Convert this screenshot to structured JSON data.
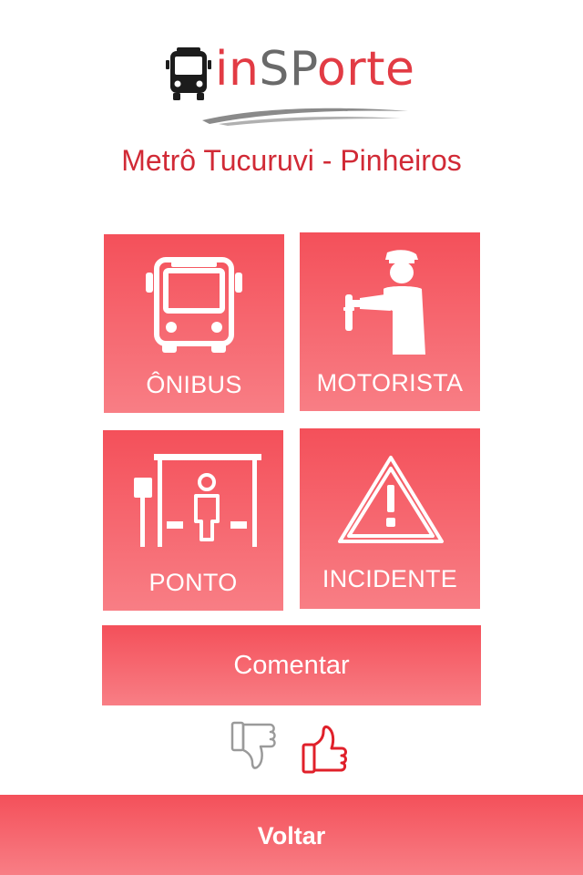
{
  "logo": {
    "text_red": "in",
    "text_gray": "SP",
    "text_red2": "orte",
    "brand_red": "#e23b44",
    "brand_gray": "#6a6a6a",
    "icon": "bus-front-icon"
  },
  "route": {
    "title": "Metrô Tucuruvi - Pinheiros"
  },
  "tiles": {
    "onibus": {
      "label": "ÔNIBUS",
      "icon": "bus-icon"
    },
    "motorista": {
      "label": "MOTORISTA",
      "icon": "driver-icon"
    },
    "ponto": {
      "label": "PONTO",
      "icon": "bus-stop-icon"
    },
    "incidente": {
      "label": "INCIDENTE",
      "icon": "warning-icon"
    }
  },
  "actions": {
    "comentar_label": "Comentar",
    "thumb_down_icon": "thumbs-down-icon",
    "thumb_up_icon": "thumbs-up-icon",
    "thumb_up_selected": true
  },
  "footer": {
    "voltar_label": "Voltar"
  },
  "colors": {
    "accent": "#f4505a",
    "accent_light": "#f87e85",
    "title_red": "#d12a36",
    "thumb_inactive": "#9a9a9a",
    "thumb_active": "#e0202a"
  }
}
